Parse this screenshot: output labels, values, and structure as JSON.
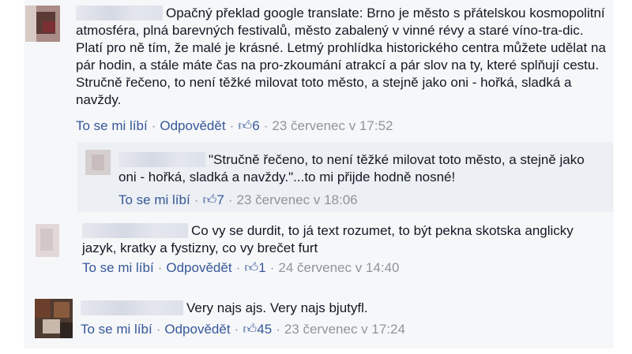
{
  "comments": [
    {
      "text": "Opačný překlad google translate: Brno je město s přátelskou kosmopolitní atmosféra, plná barevných festivalů, město zabalený v vinné révy a staré víno-tra-dic. Platí pro ně tím, že malé je krásné. Letmý prohlídka historického centra můžete udělat na pár hodin, a stále máte čas na pro-zkoumání atrakcí a pár slov na ty, které splňují cestu. Stručně řečeno, to není těžké milovat toto město, a stejně jako oni - hořká, sladká a navždy.",
      "like_label": "To se mi líbí",
      "reply_label": "Odpovědět",
      "likes": "6",
      "time": "23 červenec v 17:52",
      "reply": {
        "text": "\"Stručně řečeno, to není těžké milovat toto město, a stejně jako oni - hořká, sladká a navždy.\"...to mi přijde hodně nosné!",
        "like_label": "To se mi líbí",
        "likes": "7",
        "time": "23 červenec v 18:06"
      }
    },
    {
      "text": "Co vy se durdit, to já text rozumet, to být pekna skotska anglicky jazyk, kratky a fystizny, co vy brečet furt",
      "like_label": "To se mi líbí",
      "reply_label": "Odpovědět",
      "likes": "1",
      "time": "24 červenec v 14:40"
    },
    {
      "text": "Very najs ajs. Very najs bjutyfl.",
      "like_label": "To se mi líbí",
      "reply_label": "Odpovědět",
      "likes": "45",
      "time": "23 červenec v 17:24"
    }
  ],
  "icons": {
    "like": "thumbs-up-icon"
  },
  "colors": {
    "link": "#365899",
    "meta": "#90949c",
    "text": "#141823",
    "panel": "#f6f7f9"
  }
}
